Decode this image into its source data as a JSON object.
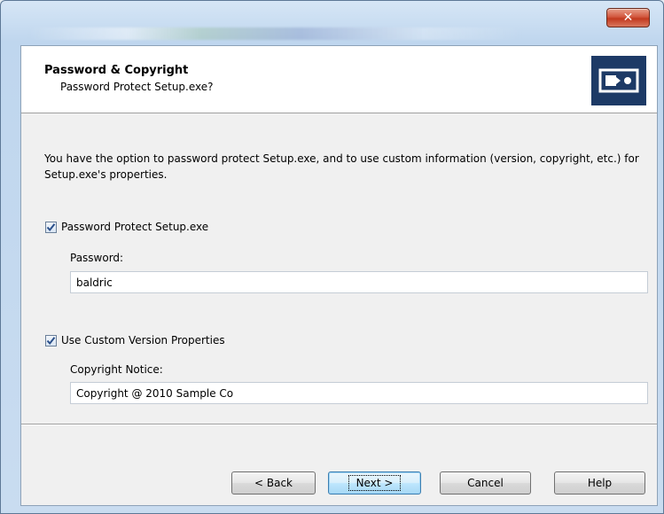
{
  "window": {
    "close_glyph": "✕"
  },
  "header": {
    "title": "Password & Copyright",
    "subtitle": "Password Protect Setup.exe?",
    "logo_icon": "setup-logo-icon"
  },
  "intro_text": "You have the option to password protect Setup.exe, and to use custom information (version, copyright, etc.) for Setup.exe's properties.",
  "password_section": {
    "checkbox_label": "Password Protect Setup.exe",
    "checked": true,
    "field_label": "Password:",
    "value": "baldric"
  },
  "version_section": {
    "checkbox_label": "Use Custom Version Properties",
    "checked": true,
    "field_label": "Copyright Notice:",
    "value": "Copyright @ 2010 Sample Co"
  },
  "buttons": {
    "back": "< Back",
    "next": "Next >",
    "cancel": "Cancel",
    "help": "Help"
  },
  "colors": {
    "logo_bg": "#1d3a66",
    "check_mark": "#2a4f8a",
    "default_button_border": "#3c7fb1"
  }
}
